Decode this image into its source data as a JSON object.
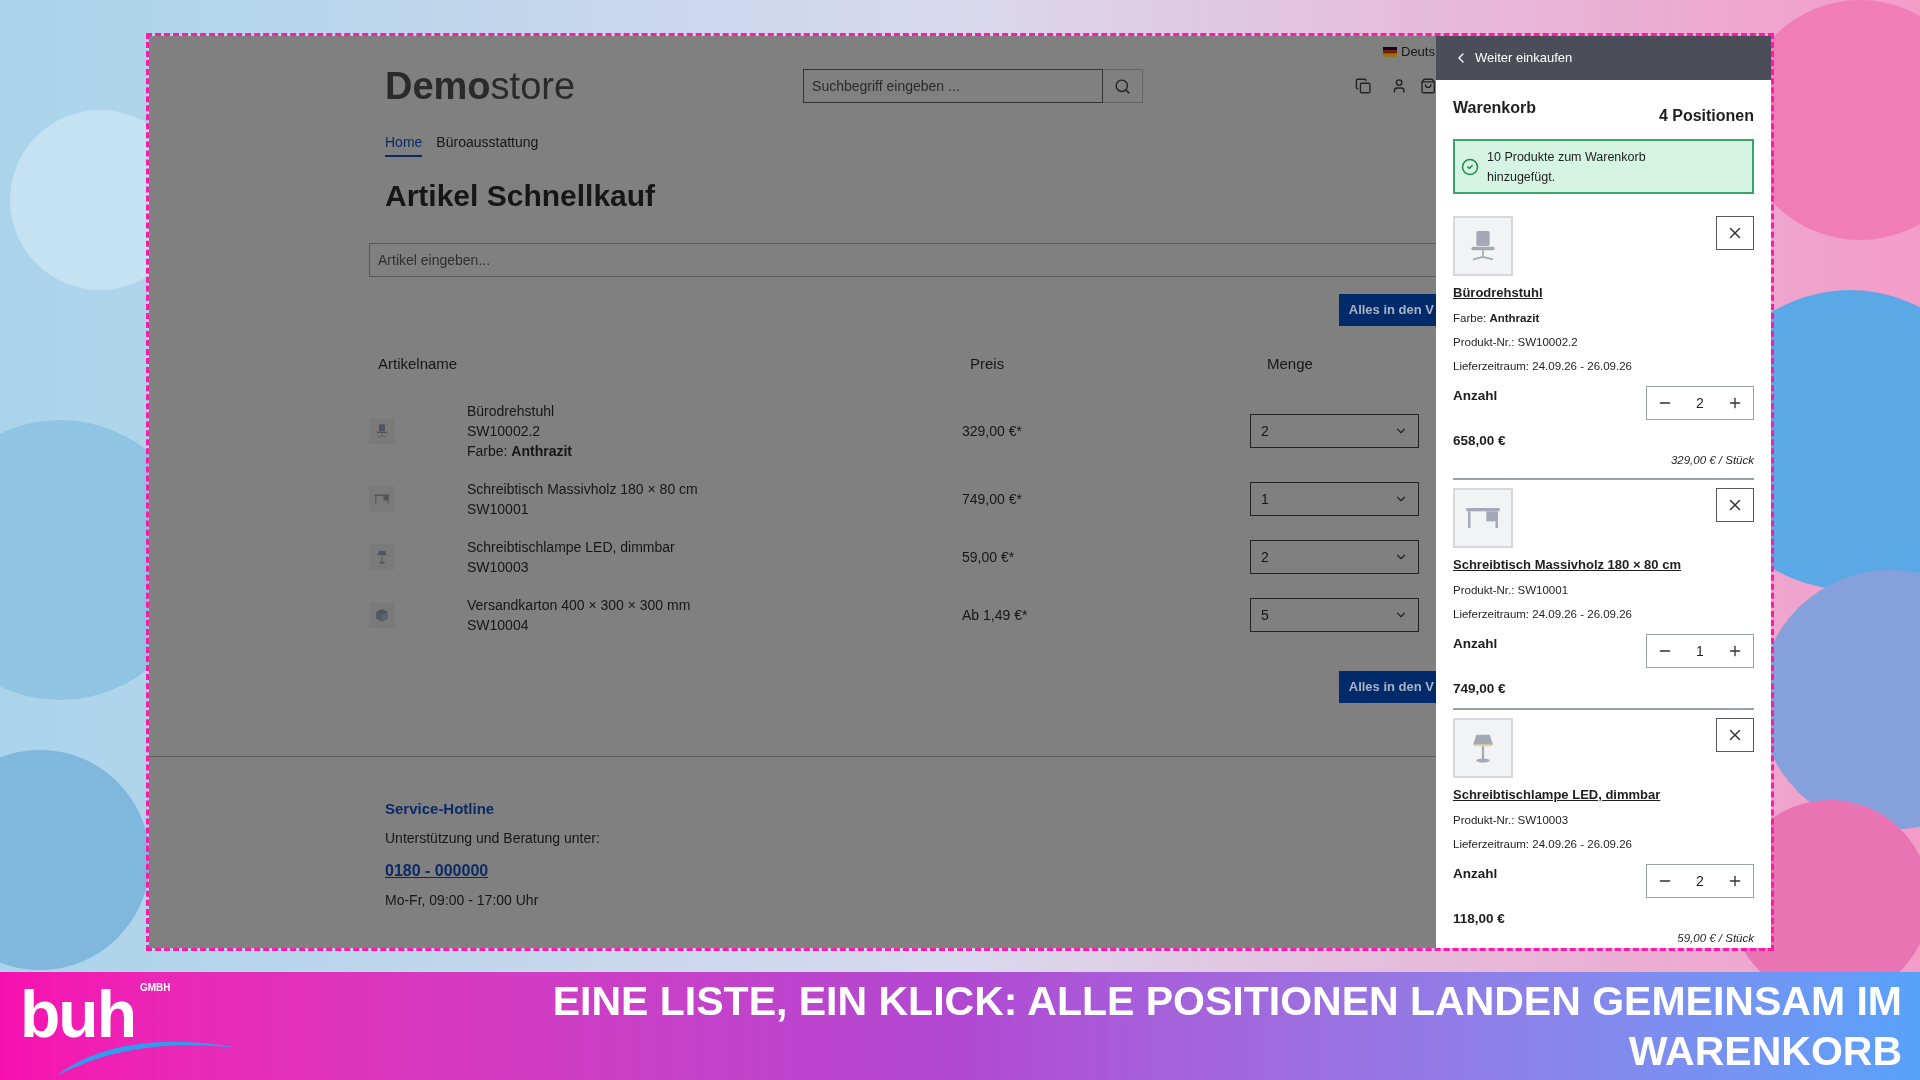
{
  "shop": {
    "language": "Deuts",
    "logo_bold": "Demo",
    "logo_light": "store",
    "search": {
      "placeholder": "Suchbegriff eingeben ..."
    },
    "breadcrumbs": [
      {
        "label": "Home",
        "selected": true
      },
      {
        "label": "Büroausstattung",
        "selected": false
      }
    ],
    "title": "Artikel Schnellkauf",
    "article_input": {
      "placeholder": "Artikel eingeben..."
    },
    "add_all_buttons": [
      "Alles in den V",
      "Alles in den V"
    ],
    "table": {
      "columns": [
        "Artikelname",
        "Preis",
        "Menge"
      ],
      "rows": [
        {
          "kind": "chair",
          "name": "Bürodrehstuhl",
          "sku": "SW10002.2",
          "variant": "Farbe: **Anthrazit**",
          "price": "329,00 €*",
          "quantity": "2"
        },
        {
          "kind": "desk",
          "name": "Schreibtisch Massivholz 180 × 80 cm",
          "sku": "SW10001",
          "price": "749,00 €*",
          "quantity": "1"
        },
        {
          "kind": "lamp",
          "name": "Schreibtischlampe LED, dimmbar",
          "sku": "SW10003",
          "price": "59,00 €*",
          "quantity": "2"
        },
        {
          "kind": "box",
          "name": "Versandkarton 400 × 300 × 300 mm",
          "sku": "SW10004",
          "price": "Ab 1,49 €*",
          "quantity": "5"
        }
      ]
    },
    "footer": {
      "heading": "Service-Hotline",
      "text": "Unterstützung und Beratung unter:",
      "phone": "0180 - 000000",
      "hours": "Mo-Fr, 09:00 - 17:00 Uhr"
    }
  },
  "cart": {
    "back": "Weiter einkaufen",
    "title": "Warenkorb",
    "count": "4 Positionen",
    "notice": "10 Produkte zum Warenkorb hinzugefügt.",
    "items": [
      {
        "kind": "chair",
        "name": "Bürodrehstuhl",
        "variant": "Farbe: **Anthrazit**",
        "sku": "Produkt-Nr.: SW10002.2",
        "delivery": "Lieferzeitraum: 24.09.26 - 26.09.26",
        "quantity_label": "Anzahl",
        "quantity": "2",
        "total": "658,00 €",
        "unit_price": "329,00 € / Stück"
      },
      {
        "kind": "desk",
        "name": "Schreibtisch Massivholz 180 × 80 cm",
        "sku": "Produkt-Nr.: SW10001",
        "delivery": "Lieferzeitraum: 24.09.26 - 26.09.26",
        "quantity_label": "Anzahl",
        "quantity": "1",
        "total": "749,00 €"
      },
      {
        "kind": "lamp",
        "name": "Schreibtischlampe LED, dimmbar",
        "sku": "Produkt-Nr.: SW10003",
        "delivery": "Lieferzeitraum: 24.09.26 - 26.09.26",
        "quantity_label": "Anzahl",
        "quantity": "2",
        "total": "118,00 €",
        "unit_price": "59,00 € / Stück"
      }
    ]
  },
  "banner": {
    "logo": "buh",
    "logo_tag": "GMBH",
    "headline": "EINE LISTE, EIN KLICK: ALLE POSITIONEN LANDEN GEMEINSAM IM WARENKORB"
  }
}
